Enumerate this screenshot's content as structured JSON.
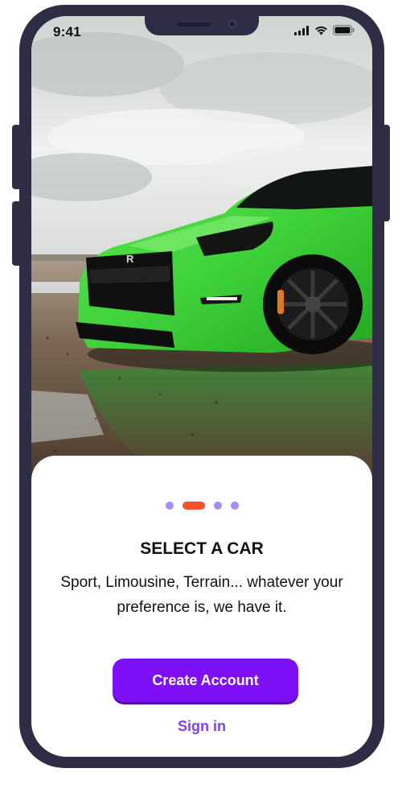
{
  "status_bar": {
    "time": "9:41",
    "icons": [
      "signal-icon",
      "wifi-icon",
      "battery-icon"
    ]
  },
  "hero": {
    "image": "green-sports-car-photo",
    "badge_text": "R"
  },
  "onboarding": {
    "page_indicator": {
      "total": 4,
      "active_index": 1
    },
    "title": "SELECT A CAR",
    "description": "Sport, Limousine, Terrain... whatever your preference is, we have it.",
    "primary_button": "Create Account",
    "secondary_link": "Sign in"
  },
  "colors": {
    "phone_frame": "#2f2c45",
    "primary": "#7e10f7",
    "link": "#7e3ff2",
    "indicator_active": "#f4512c",
    "indicator_inactive": "#a78bfa",
    "car_green": "#3fd23a"
  }
}
